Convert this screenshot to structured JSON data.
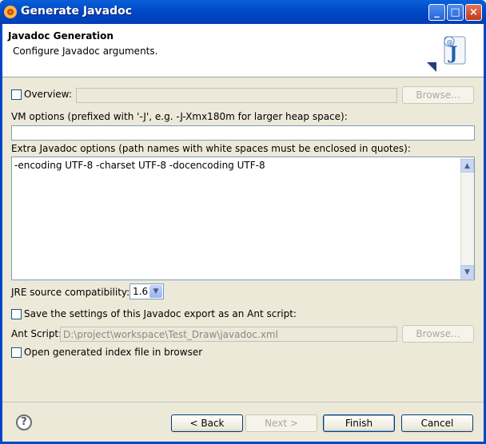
{
  "window": {
    "title": "Generate Javadoc",
    "controls": {
      "minimize": "_",
      "maximize": "□",
      "close": "×"
    }
  },
  "header": {
    "title": "Javadoc Generation",
    "description": "Configure Javadoc arguments.",
    "icon": "javadoc-wizard-icon"
  },
  "overview": {
    "label": "Overview:",
    "checked": false,
    "value": "",
    "browse_label": "Browse..."
  },
  "vm_options": {
    "label": "VM options (prefixed with '-J', e.g. -J-Xmx180m for larger heap space):",
    "value": ""
  },
  "extra_options": {
    "label": "Extra Javadoc options (path names with white spaces must be enclosed in quotes):",
    "value": "-encoding UTF-8 -charset UTF-8 -docencoding UTF-8"
  },
  "jre": {
    "label": "JRE source compatibility:",
    "selected": "1.6"
  },
  "ant": {
    "save_label": "Save the settings of this Javadoc export as an Ant script:",
    "save_checked": false,
    "script_label": "Ant Script:",
    "script_value": "D:\\project\\workspace\\Test_Draw\\javadoc.xml",
    "browse_label": "Browse..."
  },
  "open_index": {
    "label": "Open generated index file in browser",
    "checked": false
  },
  "buttons": {
    "help": "?",
    "back": "< Back",
    "next": "Next >",
    "finish": "Finish",
    "cancel": "Cancel"
  }
}
